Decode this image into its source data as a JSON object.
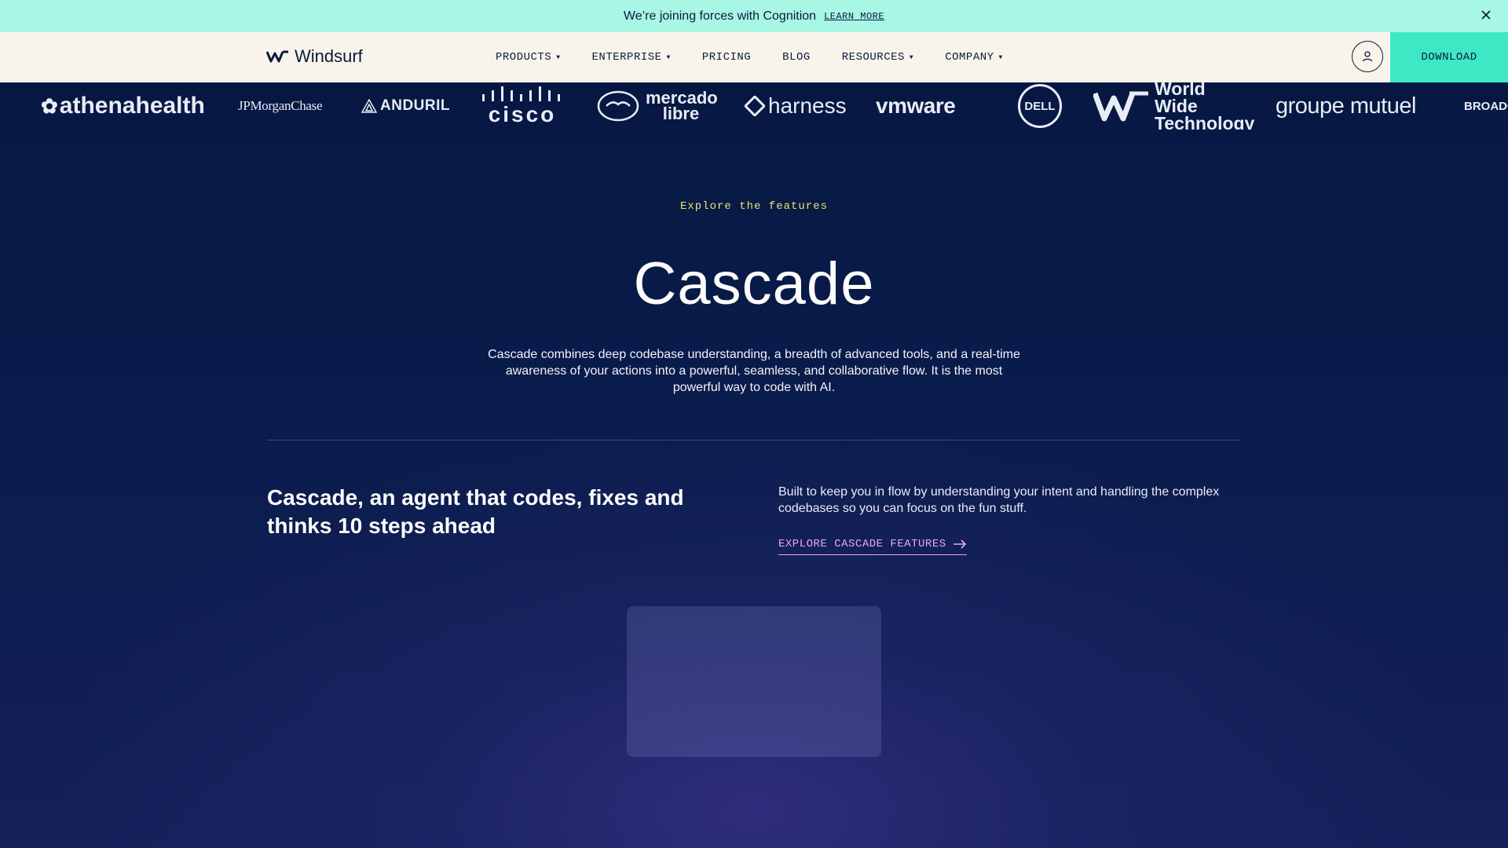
{
  "banner": {
    "text": "We’re joining forces with Cognition",
    "link": "LEARN MORE"
  },
  "nav": {
    "logo_text": "Windsurf",
    "items": [
      {
        "label": "PRODUCTS",
        "has_menu": true
      },
      {
        "label": "ENTERPRISE",
        "has_menu": true
      },
      {
        "label": "PRICING",
        "has_menu": false
      },
      {
        "label": "BLOG",
        "has_menu": false
      },
      {
        "label": "RESOURCES",
        "has_menu": true
      },
      {
        "label": "COMPANY",
        "has_menu": true
      }
    ],
    "download_label": "DOWNLOAD"
  },
  "logos": [
    "athenahealth",
    "JPMorganChase",
    "ANDURIL",
    "CISCO",
    "mercado libre",
    "harness",
    "vmware",
    "DELL",
    "World Wide Technology",
    "groupe mutuel",
    "BROADCOM"
  ],
  "hero": {
    "eyebrow": "Explore the features",
    "title": "Cascade",
    "description": "Cascade combines deep codebase understanding, a breadth of advanced tools, and a real-time awareness of your actions into a powerful, seamless, and collaborative flow. It is the most powerful way to code with AI."
  },
  "feature": {
    "headline": "Cascade, an agent that codes, fixes and thinks 10 steps ahead",
    "body": "Built to keep you in flow by understanding your intent and handling the complex codebases so you can focus on the fun stuff.",
    "cta": "EXPLORE CASCADE FEATURES"
  },
  "colors": {
    "banner_bg": "#a8f7e6",
    "nav_bg": "#f8f4ec",
    "download_bg": "#3fe8c4",
    "page_bg": "#0c1a44",
    "eyebrow": "#e9e56a",
    "cta": "#e7a8ef"
  }
}
